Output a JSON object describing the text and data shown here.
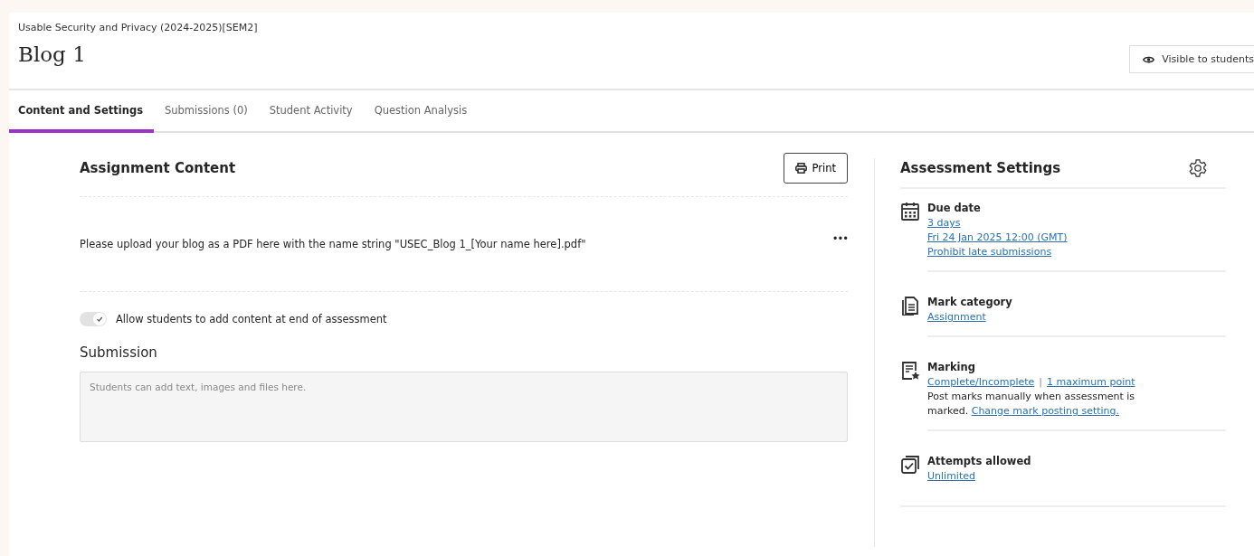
{
  "header": {
    "course": "Usable Security and Privacy (2024-2025)[SEM2]",
    "title": "Blog 1",
    "visibility": "Visible to students"
  },
  "tabs": [
    {
      "label": "Content and Settings",
      "selected": true
    },
    {
      "label": "Submissions (0)",
      "selected": false
    },
    {
      "label": "Student Activity",
      "selected": false
    },
    {
      "label": "Question Analysis",
      "selected": false
    }
  ],
  "content": {
    "heading": "Assignment Content",
    "print": "Print",
    "instructions": "Please upload your blog as a PDF here with the name string \"USEC_Blog 1_[Your name here].pdf\"",
    "more": "•••",
    "toggle": {
      "label": "Allow students to add content at end of assessment",
      "checked": true
    },
    "submission_heading": "Submission",
    "submission_placeholder": "Students can add text, images and files here."
  },
  "settings": {
    "heading": "Assessment Settings",
    "items": [
      {
        "kind": "calendar",
        "title": "Due date",
        "lines": [
          [
            {
              "text": "3 days",
              "kind": "link"
            }
          ],
          [
            {
              "text": "Fri 24 Jan 2025 12:00 (GMT)",
              "kind": "link"
            }
          ],
          [
            {
              "text": "Prohibit late submissions",
              "kind": "link"
            }
          ]
        ]
      },
      {
        "kind": "document",
        "title": "Mark category",
        "lines": [
          [
            {
              "text": "Assignment",
              "kind": "link"
            }
          ]
        ]
      },
      {
        "kind": "marking",
        "title": "Marking",
        "lines": [
          [
            {
              "text": "Complete/Incomplete",
              "kind": "link"
            },
            {
              "text": "|",
              "kind": "separator"
            },
            {
              "text": "1 maximum point",
              "kind": "link"
            }
          ]
        ],
        "note": "Post marks manually when assessment is marked.",
        "note_link": "Change mark posting setting."
      },
      {
        "kind": "attempts",
        "title": "Attempts allowed",
        "lines": [
          [
            {
              "text": "Unlimited",
              "kind": "link"
            }
          ]
        ]
      }
    ]
  }
}
